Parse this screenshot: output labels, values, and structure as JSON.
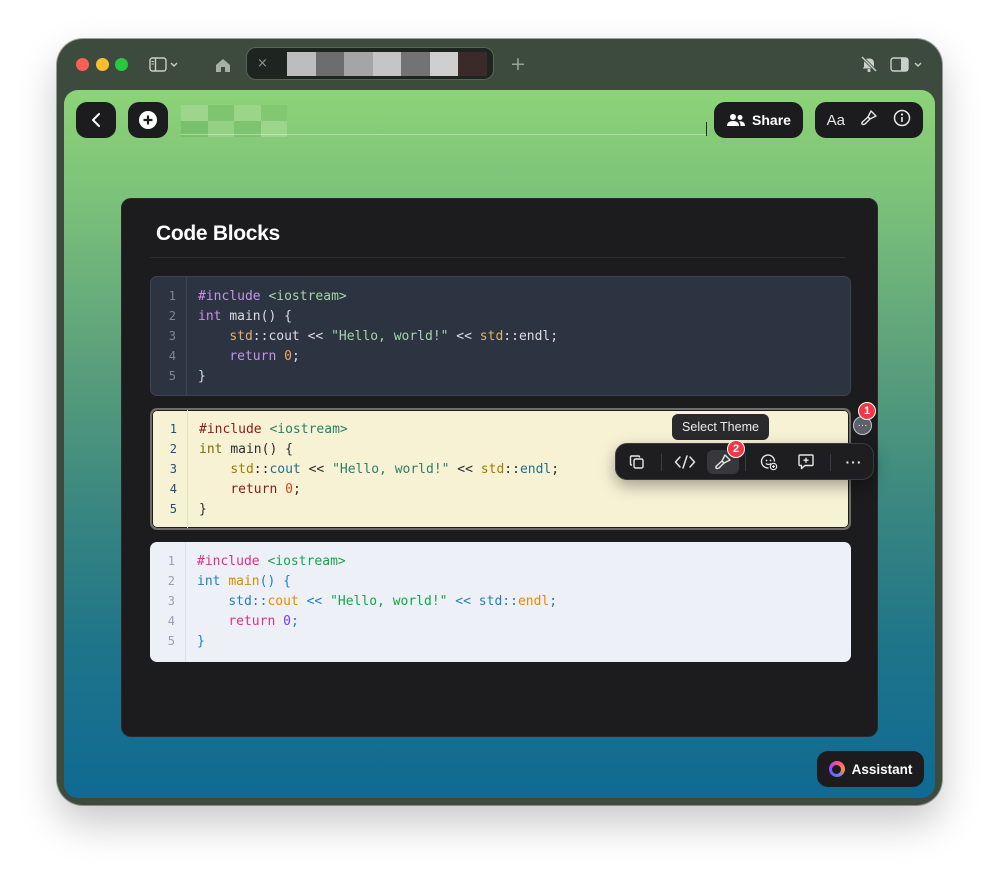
{
  "window": {
    "tab_close_glyph": "×",
    "new_tab_glyph": "+"
  },
  "toolbar": {
    "share_label": "Share",
    "font_label": "Aa"
  },
  "card": {
    "title": "Code Blocks"
  },
  "code_blocks": [
    {
      "theme": "dark",
      "line_numbers": [
        "1",
        "2",
        "3",
        "4",
        "5"
      ],
      "lines": [
        "#include <iostream>",
        "int main() {",
        "    std::cout << \"Hello, world!\" << std::endl;",
        "    return 0;",
        "}"
      ]
    },
    {
      "theme": "solarized-light",
      "line_numbers": [
        "1",
        "2",
        "3",
        "4",
        "5"
      ],
      "lines": [
        "#include <iostream>",
        "int main() {",
        "    std::cout << \"Hello, world!\" << std::endl;",
        "    return 0;",
        "}"
      ]
    },
    {
      "theme": "light",
      "line_numbers": [
        "1",
        "2",
        "3",
        "4",
        "5"
      ],
      "lines": [
        "#include <iostream>",
        "int main() {",
        "    std::cout << \"Hello, world!\" << std::endl;",
        "    return 0;",
        "}"
      ]
    }
  ],
  "block_toolbar": {
    "tooltip": "Select Theme",
    "menu_glyph": "···",
    "more_glyph": "···",
    "icons": [
      "copy-icon",
      "code-icon",
      "paintbrush-icon",
      "emoji-add-icon",
      "comment-add-icon",
      "more-icon"
    ]
  },
  "badges": {
    "badge_1": "1",
    "badge_2": "2"
  },
  "assistant": {
    "label": "Assistant"
  },
  "colors": {
    "accent_badge": "#ef3a46",
    "gradient_top": "#8dd377",
    "gradient_bottom": "#0f6a94",
    "card_bg": "#1c1c1e"
  }
}
